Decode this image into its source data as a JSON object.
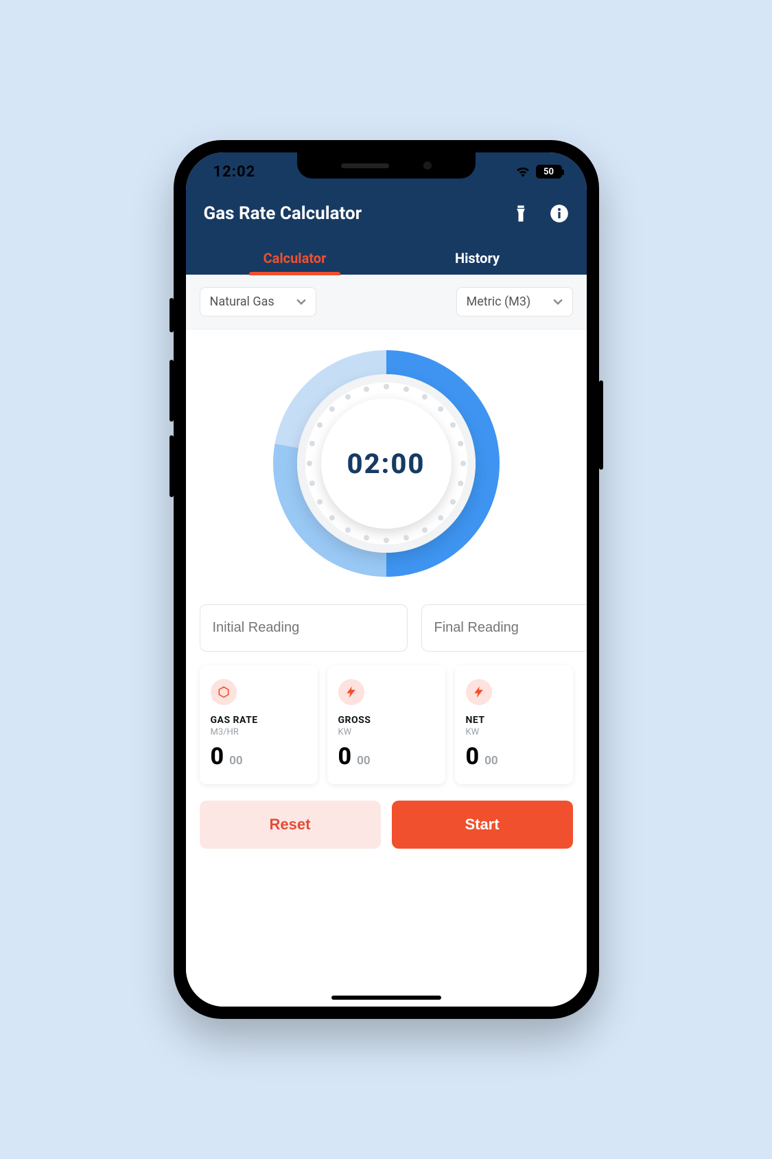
{
  "status": {
    "time": "12:02",
    "battery": "50"
  },
  "header": {
    "title": "Gas Rate Calculator"
  },
  "tabs": {
    "calculator": "Calculator",
    "history": "History"
  },
  "dropdowns": {
    "gas_type": "Natural Gas",
    "unit": "Metric (M3)"
  },
  "timer": {
    "display": "02:00"
  },
  "readings": {
    "initial_placeholder": "Initial Reading",
    "final_placeholder": "Final Reading"
  },
  "cards": {
    "gas_rate": {
      "title": "GAS RATE",
      "unit": "M3/HR",
      "big": "0",
      "small": "00"
    },
    "gross": {
      "title": "GROSS",
      "unit": "KW",
      "big": "0",
      "small": "00"
    },
    "net": {
      "title": "NET",
      "unit": "KW",
      "big": "0",
      "small": "00"
    }
  },
  "actions": {
    "reset": "Reset",
    "start": "Start"
  }
}
